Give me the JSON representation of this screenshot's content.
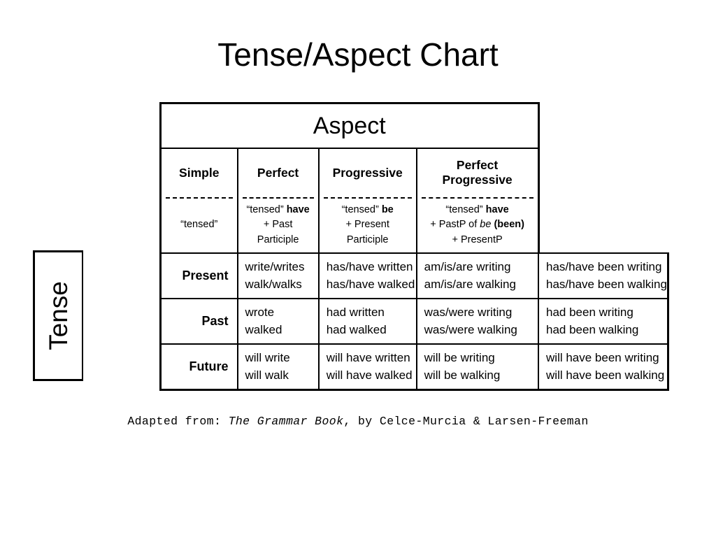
{
  "page": {
    "title": "Tense/Aspect Chart",
    "background_color": "#ffffff",
    "text_color": "#000000"
  },
  "chart": {
    "aspect_header": "Aspect",
    "tense_header": "Tense",
    "aspect_columns": [
      {
        "name": "Simple",
        "formula_lines": [
          "“tensed”"
        ],
        "formula_plain": "“tensed”"
      },
      {
        "name": "Perfect",
        "formula_lines": [
          "“tensed” have",
          "+ Past Participle"
        ],
        "formula_plain": "“tensed” have + Past Participle"
      },
      {
        "name": "Progressive",
        "formula_lines": [
          "“tensed” be",
          "+ Present Participle"
        ],
        "formula_plain": "“tensed” be + Present Participle"
      },
      {
        "name": "Perfect Progressive",
        "formula_lines": [
          "“tensed” have",
          "+ PastP of be (been)",
          "+ PresentP"
        ],
        "formula_plain": "“tensed” have + PastP of be (been) + PresentP"
      }
    ],
    "formula_fragments": {
      "simple": {
        "quoted": "“tensed”"
      },
      "perfect": {
        "quoted": "“tensed”",
        "bold": "have",
        "line2": "+ Past Participle"
      },
      "progressive": {
        "quoted": "“tensed”",
        "bold": "be",
        "line2": "+ Present Participle"
      },
      "perfect_progressive": {
        "quoted": "“tensed”",
        "bold": "have",
        "line2_pre": "+ PastP of ",
        "line2_italic": "be",
        "line2_bold": "(been)",
        "line3": "+ PresentP"
      }
    },
    "rows": [
      {
        "tense": "Present",
        "cells": [
          [
            "write/writes",
            "walk/walks"
          ],
          [
            "has/have written",
            "has/have walked"
          ],
          [
            "am/is/are writing",
            "am/is/are walking"
          ],
          [
            "has/have been writing",
            "has/have been walking"
          ]
        ]
      },
      {
        "tense": "Past",
        "cells": [
          [
            "wrote",
            "walked"
          ],
          [
            "had written",
            "had walked"
          ],
          [
            "was/were writing",
            "was/were walking"
          ],
          [
            "had been writing",
            "had been walking"
          ]
        ]
      },
      {
        "tense": "Future",
        "cells": [
          [
            "will write",
            "will walk"
          ],
          [
            "will have written",
            "will have walked"
          ],
          [
            "will be writing",
            "will be walking"
          ],
          [
            "will have been writing",
            "will have been walking"
          ]
        ]
      }
    ]
  },
  "footer": {
    "prefix": "Adapted from: ",
    "source_title": "The Grammar Book",
    "suffix": ", by Celce-Murcia & Larsen-Freeman"
  }
}
